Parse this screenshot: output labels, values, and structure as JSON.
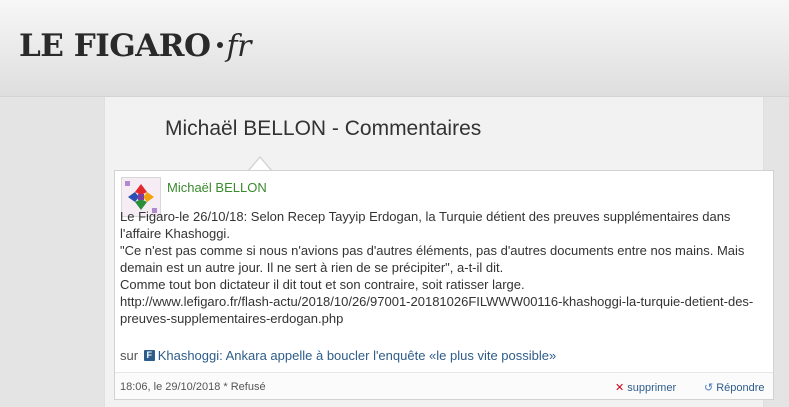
{
  "logo": {
    "brand": "LE FIGARO",
    "suffix": "fr"
  },
  "page_title": "Michaël BELLON - Commentaires",
  "comment": {
    "author": "Michaël BELLON",
    "body": "Le Figaro-le 26/10/18: Selon Recep Tayyip Erdogan, la Turquie détient des preuves supplémentaires dans l'affaire Khashoggi.\n\"Ce n'est pas comme si nous n'avions pas d'autres éléments, pas d'autres documents entre nos mains. Mais demain est un autre jour. Il ne sert à rien de se précipiter\", a-t-il dit.\nComme tout bon dictateur il dit tout et son contraire, soit ratisser large.\nhttp://www.lefigaro.fr/flash-actu/2018/10/26/97001-20181026FILWWW00116-khashoggi-la-turquie-detient-des-preuves-supplementaires-erdogan.php",
    "source_prefix": "sur",
    "source_icon": "F",
    "source_link": "Khashoggi: Ankara appelle à boucler l'enquête «le plus vite possible»",
    "timestamp": "18:06, le 29/10/2018",
    "status": "* Refusé",
    "delete_label": "supprimer",
    "reply_label": "Répondre"
  },
  "colors": {
    "author": "#3a8a2e",
    "link": "#2e5c8a",
    "delete_icon": "#d0021b"
  }
}
